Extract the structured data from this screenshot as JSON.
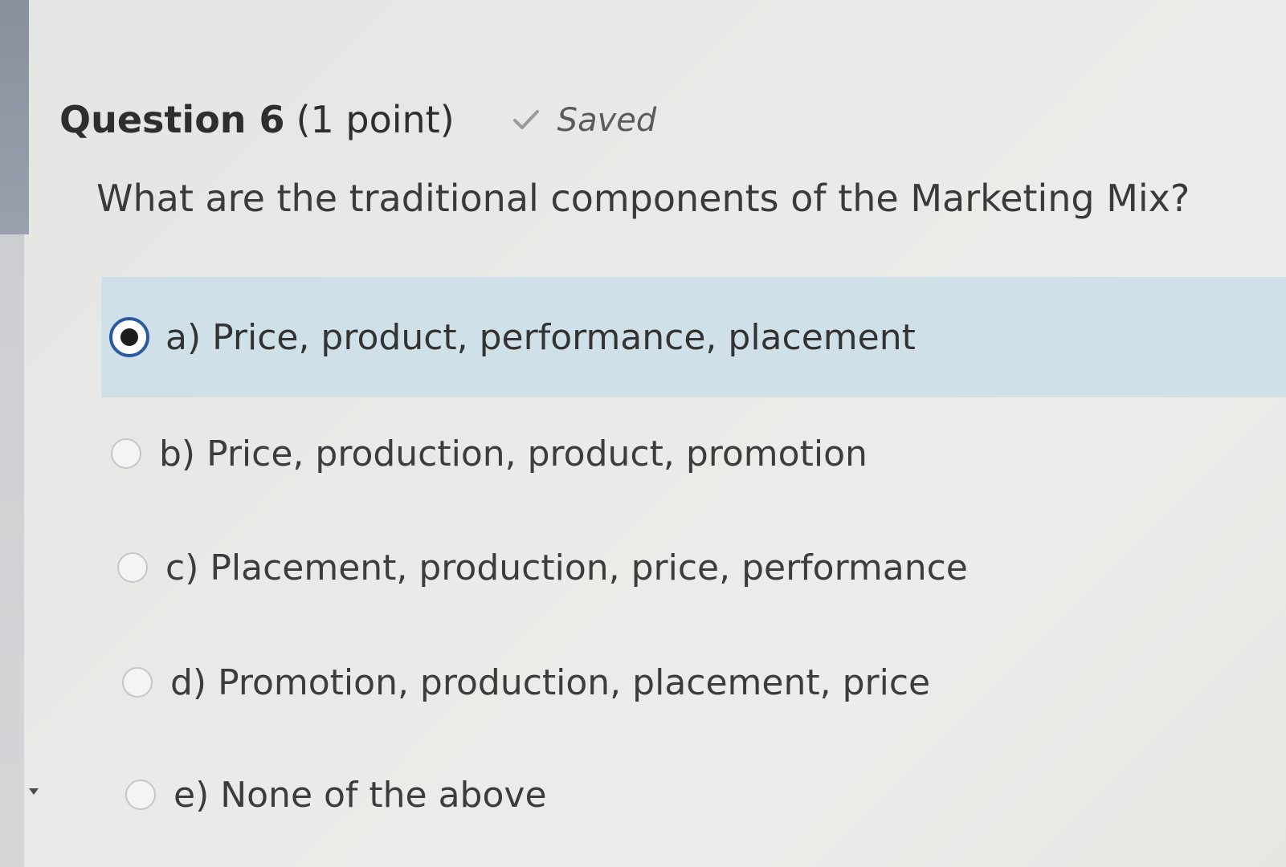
{
  "question": {
    "title": "Question 6",
    "points": "(1 point)",
    "status": "Saved",
    "status_icon": "check-icon",
    "prompt": "What are the traditional components of the Marketing Mix?"
  },
  "options": [
    {
      "label": "a) Price, product, performance, placement",
      "selected": true
    },
    {
      "label": "b) Price, production, product, promotion",
      "selected": false
    },
    {
      "label": "c) Placement, production, price, performance",
      "selected": false
    },
    {
      "label": "d) Promotion, production, placement, price",
      "selected": false
    },
    {
      "label": "e) None of the above",
      "selected": false
    }
  ],
  "colors": {
    "selected_background": "#cfe0e8",
    "radio_checked_border": "#2b5aa0",
    "saved_check": "#9a9a9a"
  }
}
